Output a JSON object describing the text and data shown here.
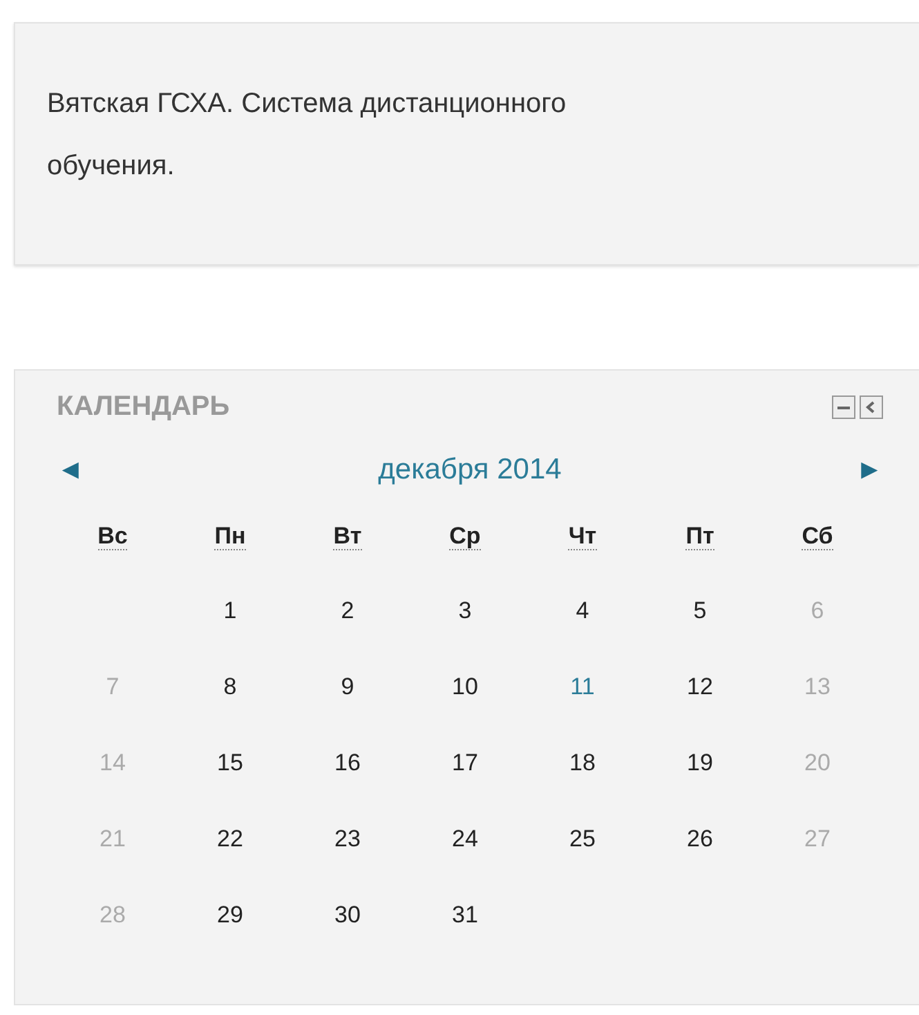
{
  "site_block": {
    "text": "Вятская ГСХА. Система дистанционного обучения."
  },
  "calendar": {
    "title": "КАЛЕНДАРЬ",
    "month": "декабря 2014",
    "prev": "◄",
    "next": "►",
    "weekdays": [
      "Вс",
      "Пн",
      "Вт",
      "Ср",
      "Чт",
      "Пт",
      "Сб"
    ],
    "weeks": [
      [
        {
          "day": "1",
          "kind": "weekday"
        },
        {
          "day": "2",
          "kind": "weekday"
        },
        {
          "day": "3",
          "kind": "weekday"
        },
        {
          "day": "4",
          "kind": "weekday"
        },
        {
          "day": "5",
          "kind": "weekday"
        },
        {
          "day": "6",
          "kind": "weekend"
        }
      ],
      [
        {
          "day": "7",
          "kind": "weekend"
        },
        {
          "day": "8",
          "kind": "weekday"
        },
        {
          "day": "9",
          "kind": "weekday"
        },
        {
          "day": "10",
          "kind": "weekday"
        },
        {
          "day": "11",
          "kind": "today"
        },
        {
          "day": "12",
          "kind": "weekday"
        },
        {
          "day": "13",
          "kind": "weekend"
        }
      ],
      [
        {
          "day": "14",
          "kind": "weekend"
        },
        {
          "day": "15",
          "kind": "weekday"
        },
        {
          "day": "16",
          "kind": "weekday"
        },
        {
          "day": "17",
          "kind": "weekday"
        },
        {
          "day": "18",
          "kind": "weekday"
        },
        {
          "day": "19",
          "kind": "weekday"
        },
        {
          "day": "20",
          "kind": "weekend"
        }
      ],
      [
        {
          "day": "21",
          "kind": "weekend"
        },
        {
          "day": "22",
          "kind": "weekday"
        },
        {
          "day": "23",
          "kind": "weekday"
        },
        {
          "day": "24",
          "kind": "weekday"
        },
        {
          "day": "25",
          "kind": "weekday"
        },
        {
          "day": "26",
          "kind": "weekday"
        },
        {
          "day": "27",
          "kind": "weekend"
        }
      ],
      [
        {
          "day": "28",
          "kind": "weekend"
        },
        {
          "day": "29",
          "kind": "weekday"
        },
        {
          "day": "30",
          "kind": "weekday"
        },
        {
          "day": "31",
          "kind": "weekday"
        }
      ]
    ]
  }
}
